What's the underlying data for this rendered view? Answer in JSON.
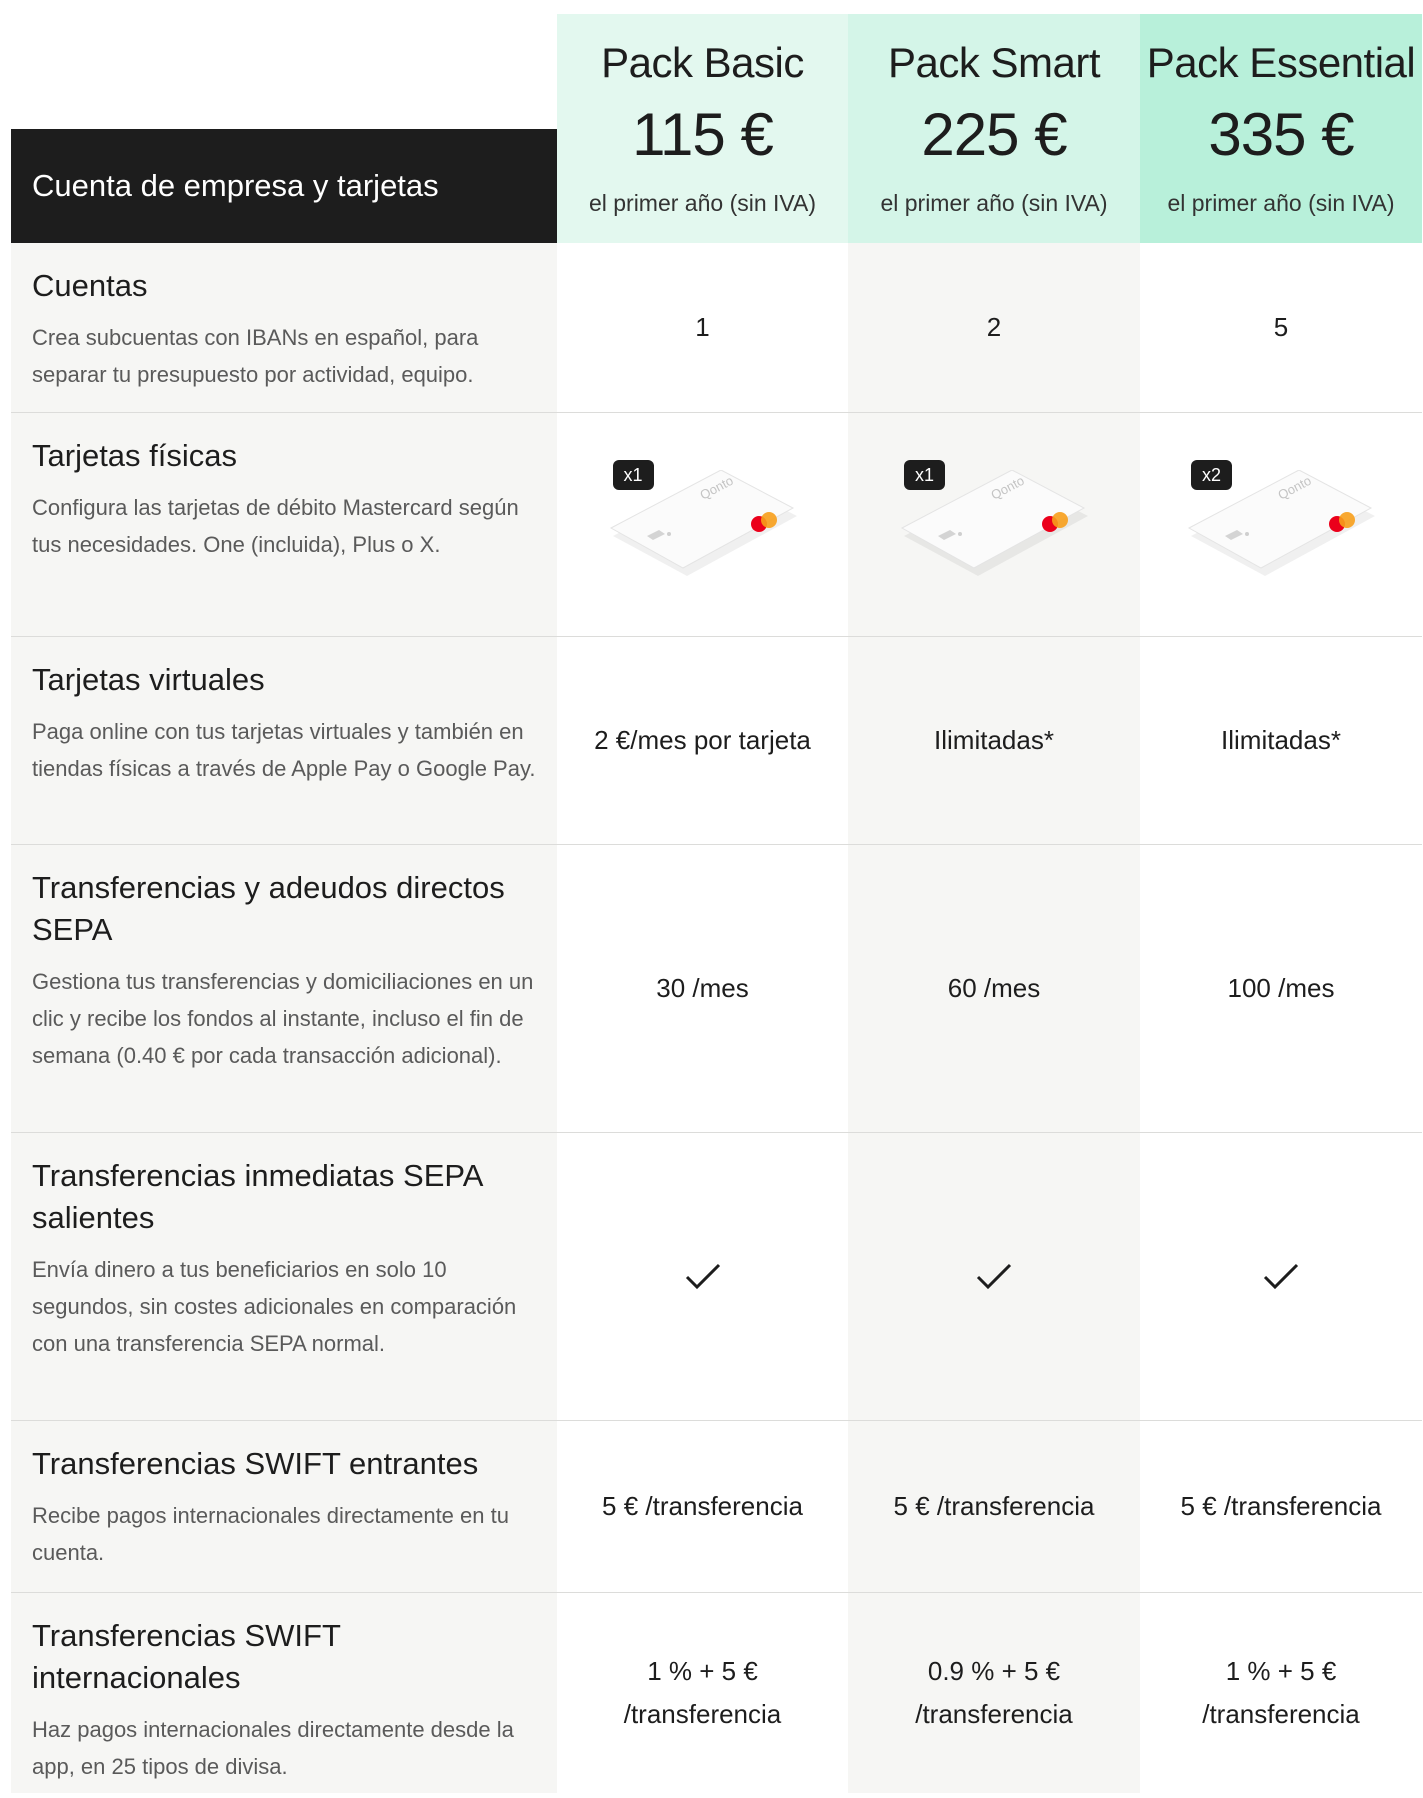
{
  "section_title": "Cuenta de empresa y tarjetas",
  "plans": [
    {
      "name": "Pack Basic",
      "price": "115 €",
      "note": "el primer año (sin IVA)"
    },
    {
      "name": "Pack Smart",
      "price": "225 €",
      "note": "el primer año (sin IVA)"
    },
    {
      "name": "Pack Essential",
      "price": "335 €",
      "note": "el primer año (sin IVA)"
    }
  ],
  "features": [
    {
      "title": "Cuentas",
      "desc": "Crea subcuentas con IBANs en español, para separar tu presupuesto por actividad, equipo.",
      "values": [
        "1",
        "2",
        "5"
      ]
    },
    {
      "title": "Tarjetas físicas",
      "desc": "Configura las tarjetas de débito Mastercard según tus necesidades. One (incluida), Plus o X.",
      "card_counts": [
        "x1",
        "x1",
        "x2"
      ],
      "card_brand": "Qonto",
      "card_icon": "payment-card-icon"
    },
    {
      "title": "Tarjetas virtuales",
      "desc": "Paga online con tus tarjetas virtuales y también en tiendas físicas a través de Apple Pay o Google Pay.",
      "values": [
        "2 €/mes por tarjeta",
        "Ilimitadas*",
        "Ilimitadas*"
      ]
    },
    {
      "title": "Transferencias y adeudos directos SEPA",
      "desc": "Gestiona tus transferencias y domiciliaciones en un clic y recibe los fondos al instante, incluso el fin de semana (0.40 € por cada transacción adicional).",
      "values": [
        "30 /mes",
        "60 /mes",
        "100 /mes"
      ]
    },
    {
      "title": "Transferencias inmediatas SEPA salientes",
      "desc": "Envía dinero a tus beneficiarios en solo 10 segundos, sin costes adicionales en comparación con una transferencia SEPA normal.",
      "included": [
        true,
        true,
        true
      ],
      "included_icon": "checkmark-icon"
    },
    {
      "title": "Transferencias SWIFT entrantes",
      "desc": "Recibe pagos internacionales directamente en tu cuenta.",
      "values": [
        "5 € /transferencia",
        "5 € /transferencia",
        "5 € /transferencia"
      ]
    },
    {
      "title": "Transferencias SWIFT internacionales",
      "desc": "Haz pagos internacionales directamente desde la app, en 25 tipos de divisa.",
      "values": [
        "1 % + 5 €\n/transferencia",
        "0.9 % + 5 €\n/transferencia",
        "1 % + 5 €\n/transferencia"
      ]
    }
  ],
  "colors": {
    "header_dark": "#1d1d1d",
    "basic_bg": "#e3f8ef",
    "smart_bg": "#d4f5e8",
    "essential_bg": "#b8f0da",
    "row_shade": "#f6f6f4",
    "mastercard_red": "#eb001b",
    "mastercard_orange": "#f79e1b"
  }
}
